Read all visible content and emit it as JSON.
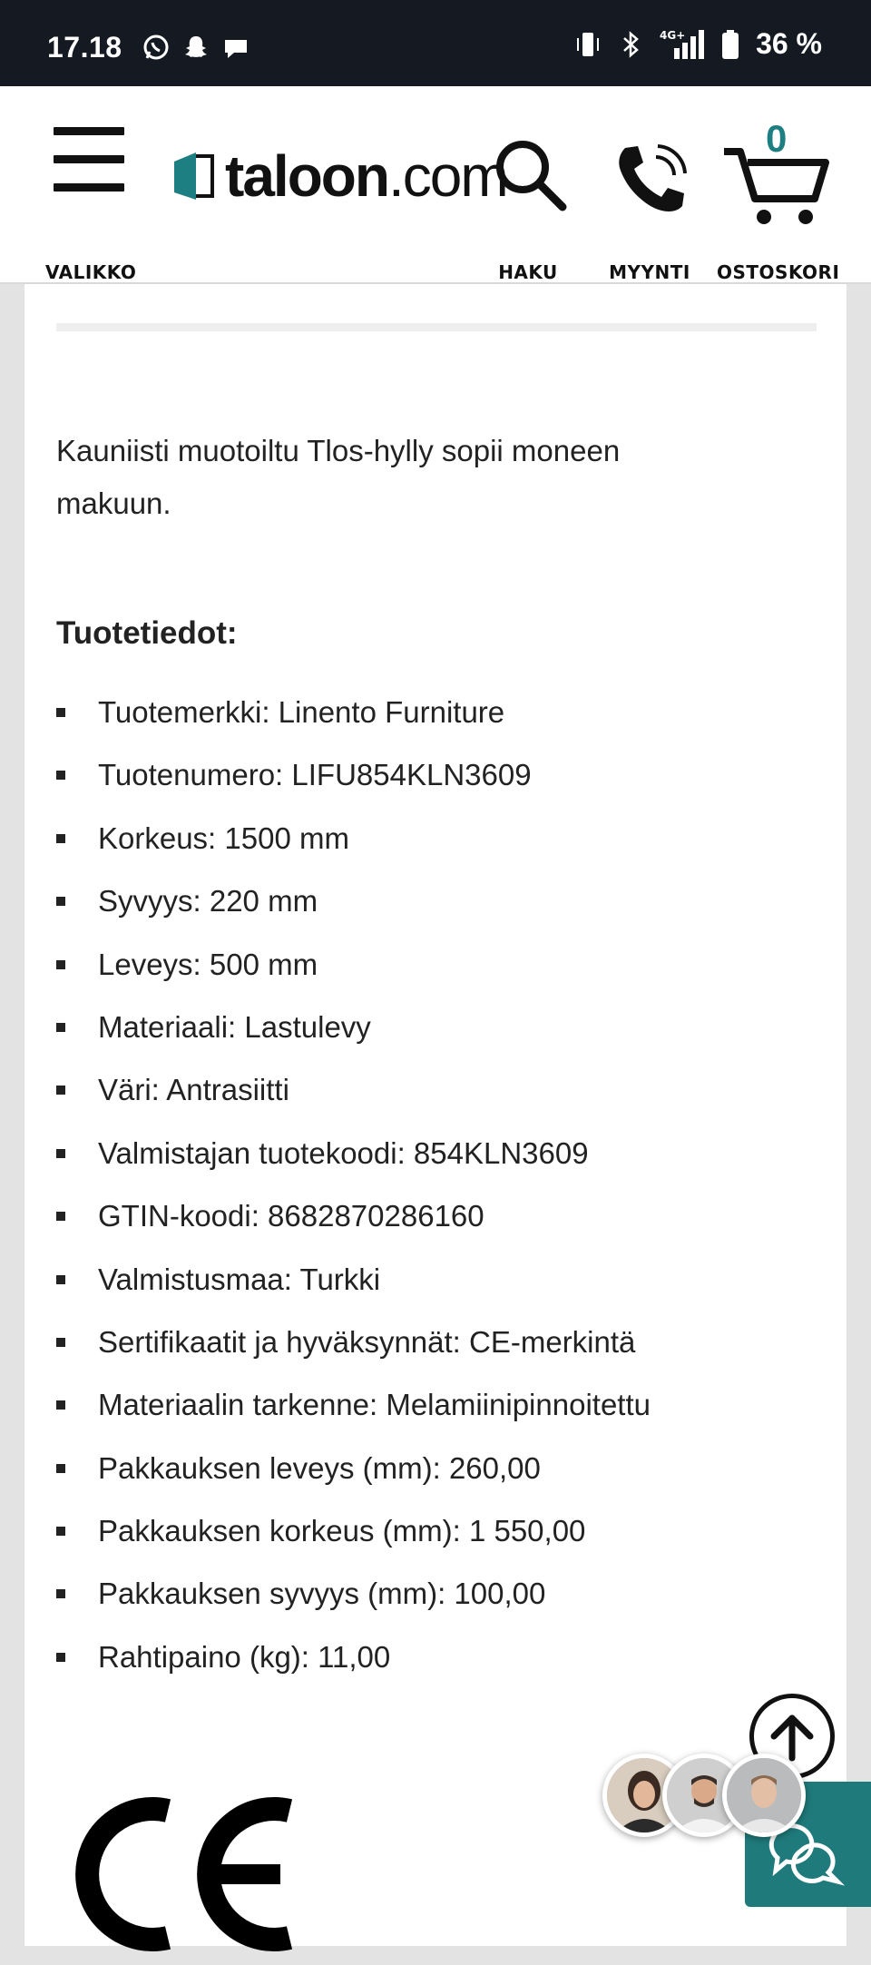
{
  "status_bar": {
    "time": "17.18",
    "battery": "36 %",
    "network": "4G+",
    "left_icons": [
      "whatsapp-icon",
      "snapchat-icon",
      "message-icon"
    ],
    "right_icons": [
      "vibrate-icon",
      "bluetooth-icon",
      "signal-icon",
      "battery-icon"
    ]
  },
  "header": {
    "menu_label": "VALIKKO",
    "logo_text_bold": "taloon",
    "logo_text_thin": ".com",
    "search_label": "HAKU",
    "sales_label": "MYYNTI",
    "cart_label": "OSTOSKORI",
    "cart_count": "0",
    "brand_color": "#1d7f82"
  },
  "content": {
    "intro": "Kauniisti muotoiltu Tlos-hylly sopii moneen makuun.",
    "section_title": "Tuotetiedot:",
    "specs": [
      "Tuotemerkki: Linento Furniture",
      "Tuotenumero: LIFU854KLN3609",
      "Korkeus: 1500 mm",
      "Syvyys: 220 mm",
      "Leveys: 500 mm",
      "Materiaali: Lastulevy",
      "Väri: Antrasiitti",
      "Valmistajan tuotekoodi: 854KLN3609",
      "GTIN-koodi: 8682870286160",
      "Valmistusmaa: Turkki",
      "Sertifikaatit ja hyväksynnät: CE-merkintä",
      "Materiaalin tarkenne: Melamiinipinnoitettu",
      "Pakkauksen leveys (mm): 260,00",
      "Pakkauksen korkeus (mm): 1 550,00",
      "Pakkauksen syvyys (mm): 100,00",
      "Rahtipaino (kg): 11,00"
    ],
    "certification_mark": "CE"
  },
  "floating": {
    "scroll_top_icon": "arrow-up-icon",
    "chat_icon": "chat-bubbles-icon",
    "chat_color": "#1f7a7b"
  }
}
